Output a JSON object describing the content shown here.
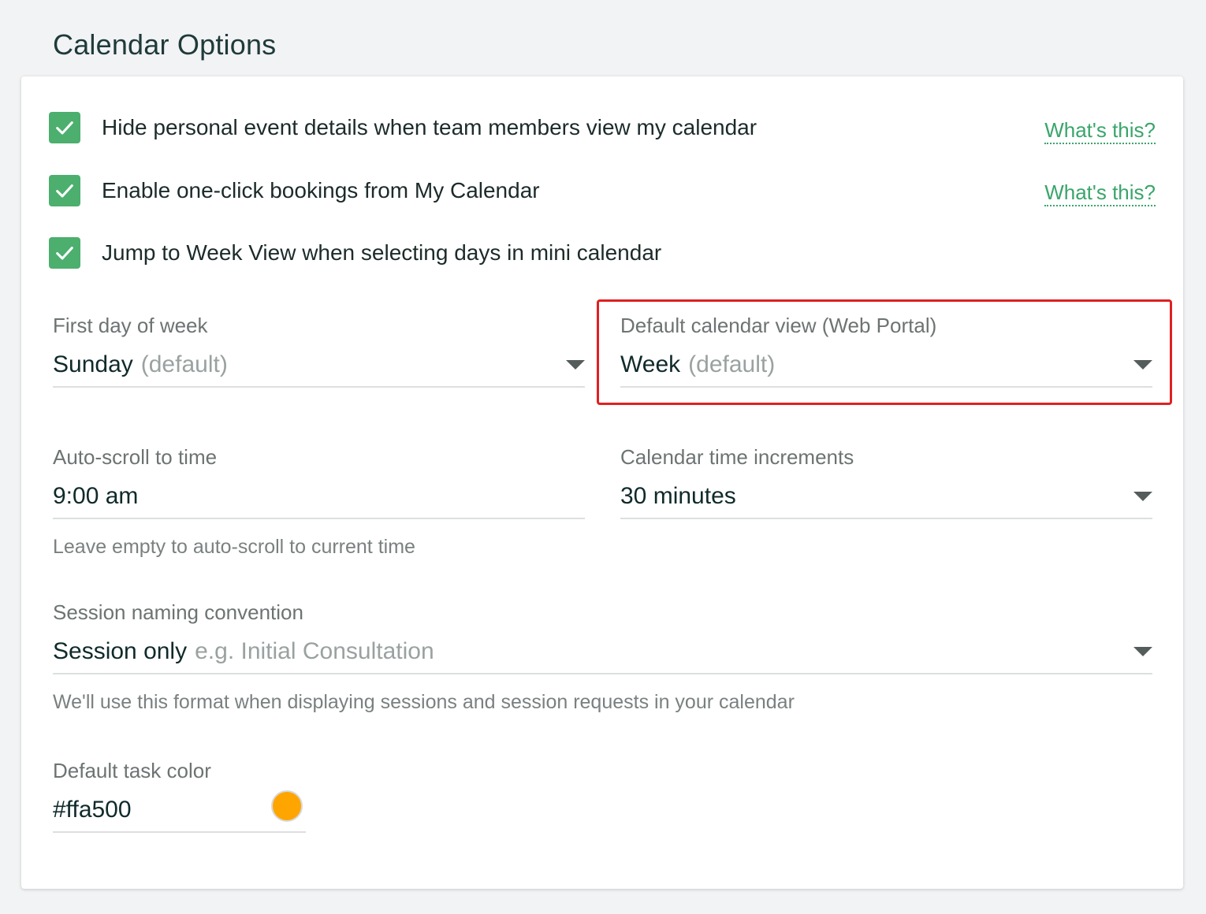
{
  "page_title": "Calendar Options",
  "checkboxes": [
    {
      "label": "Hide personal event details when team members view my calendar",
      "checked": true,
      "help_link": "What's this?"
    },
    {
      "label": "Enable one-click bookings from My Calendar",
      "checked": true,
      "help_link": "What's this?"
    },
    {
      "label": "Jump to Week View when selecting days in mini calendar",
      "checked": true
    }
  ],
  "first_day_of_week": {
    "label": "First day of week",
    "value": "Sunday",
    "suffix": "(default)"
  },
  "default_calendar_view": {
    "label": "Default calendar view (Web Portal)",
    "value": "Week",
    "suffix": "(default)"
  },
  "auto_scroll": {
    "label": "Auto-scroll to time",
    "value": "9:00 am",
    "helper": "Leave empty to auto-scroll to current time"
  },
  "time_increments": {
    "label": "Calendar time increments",
    "value": "30 minutes"
  },
  "session_naming": {
    "label": "Session naming convention",
    "value": "Session only",
    "example": "e.g. Initial Consultation",
    "helper": "We'll use this format when displaying sessions and session requests in your calendar"
  },
  "task_color": {
    "label": "Default task color",
    "value": "#ffa500",
    "swatch_color": "#ffa500"
  },
  "colors": {
    "checkbox": "#4caf6e",
    "link": "#3aa56b",
    "highlight": "#e02020"
  }
}
